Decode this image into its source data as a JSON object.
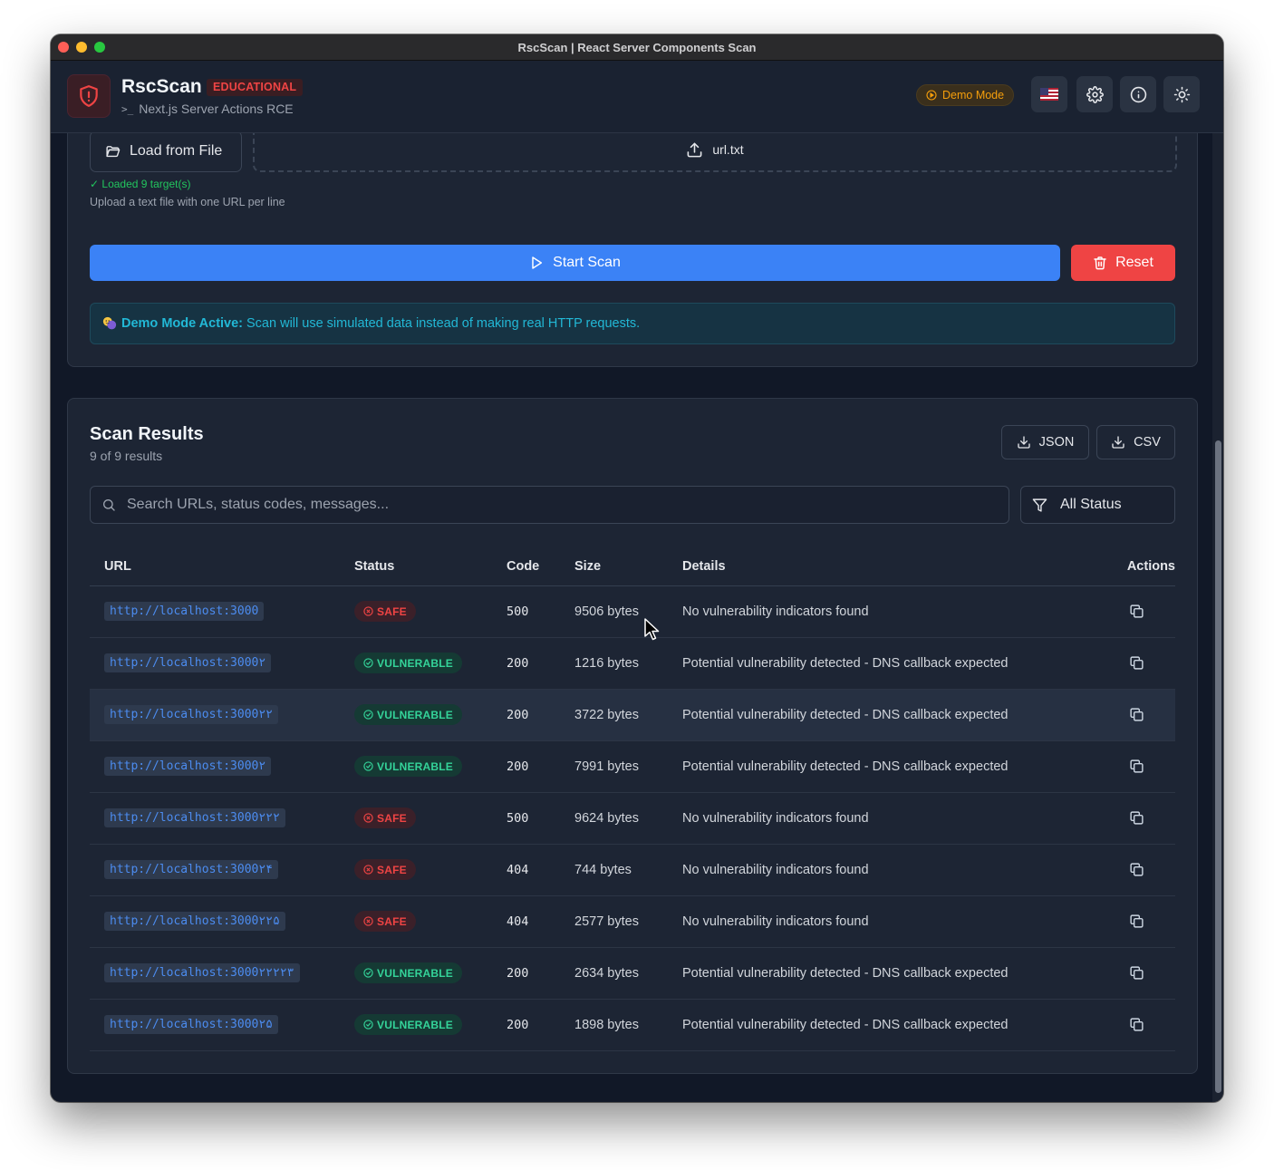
{
  "window": {
    "title": "RscScan | React Server Components Scan"
  },
  "header": {
    "app_name": "RscScan",
    "badge": "EDUCATIONAL",
    "subtitle": "Next.js Server Actions RCE",
    "demo_mode_label": "Demo Mode"
  },
  "input_card": {
    "load_file_label": "Load from File",
    "file_name": "url.txt",
    "loaded_status": "✓ Loaded 9 target(s)",
    "upload_hint": "Upload a text file with one URL per line",
    "start_label": "Start Scan",
    "reset_label": "Reset",
    "demo_banner_bold": "Demo Mode Active:",
    "demo_banner_text": "Scan will use simulated data instead of making real HTTP requests."
  },
  "results": {
    "title": "Scan Results",
    "count_text": "9 of 9 results",
    "json_label": "JSON",
    "csv_label": "CSV",
    "search_placeholder": "Search URLs, status codes, messages...",
    "filter_value": "All Status",
    "columns": [
      "URL",
      "Status",
      "Code",
      "Size",
      "Details",
      "Actions"
    ],
    "rows": [
      {
        "url": "http://localhost:3000",
        "status": "SAFE",
        "code": "500",
        "size": "9506 bytes",
        "details": "No vulnerability indicators found"
      },
      {
        "url": "http://localhost:3000۲",
        "status": "VULNERABLE",
        "code": "200",
        "size": "1216 bytes",
        "details": "Potential vulnerability detected - DNS callback expected"
      },
      {
        "url": "http://localhost:3000۲۲",
        "status": "VULNERABLE",
        "code": "200",
        "size": "3722 bytes",
        "details": "Potential vulnerability detected - DNS callback expected"
      },
      {
        "url": "http://localhost:3000۲",
        "status": "VULNERABLE",
        "code": "200",
        "size": "7991 bytes",
        "details": "Potential vulnerability detected - DNS callback expected"
      },
      {
        "url": "http://localhost:3000۲۲۲",
        "status": "SAFE",
        "code": "500",
        "size": "9624 bytes",
        "details": "No vulnerability indicators found"
      },
      {
        "url": "http://localhost:3000۲۴",
        "status": "SAFE",
        "code": "404",
        "size": "744 bytes",
        "details": "No vulnerability indicators found"
      },
      {
        "url": "http://localhost:3000۲۲۵",
        "status": "SAFE",
        "code": "404",
        "size": "2577 bytes",
        "details": "No vulnerability indicators found"
      },
      {
        "url": "http://localhost:3000۲۲۲۲۳",
        "status": "VULNERABLE",
        "code": "200",
        "size": "2634 bytes",
        "details": "Potential vulnerability detected - DNS callback expected"
      },
      {
        "url": "http://localhost:3000۲۵",
        "status": "VULNERABLE",
        "code": "200",
        "size": "1898 bytes",
        "details": "Potential vulnerability detected - DNS callback expected"
      }
    ]
  },
  "colors": {
    "accent_blue": "#3b82f6",
    "danger_red": "#ef4444",
    "safe_green": "#34d399",
    "demo_amber": "#f59e0b",
    "info_cyan": "#22b8d6"
  }
}
